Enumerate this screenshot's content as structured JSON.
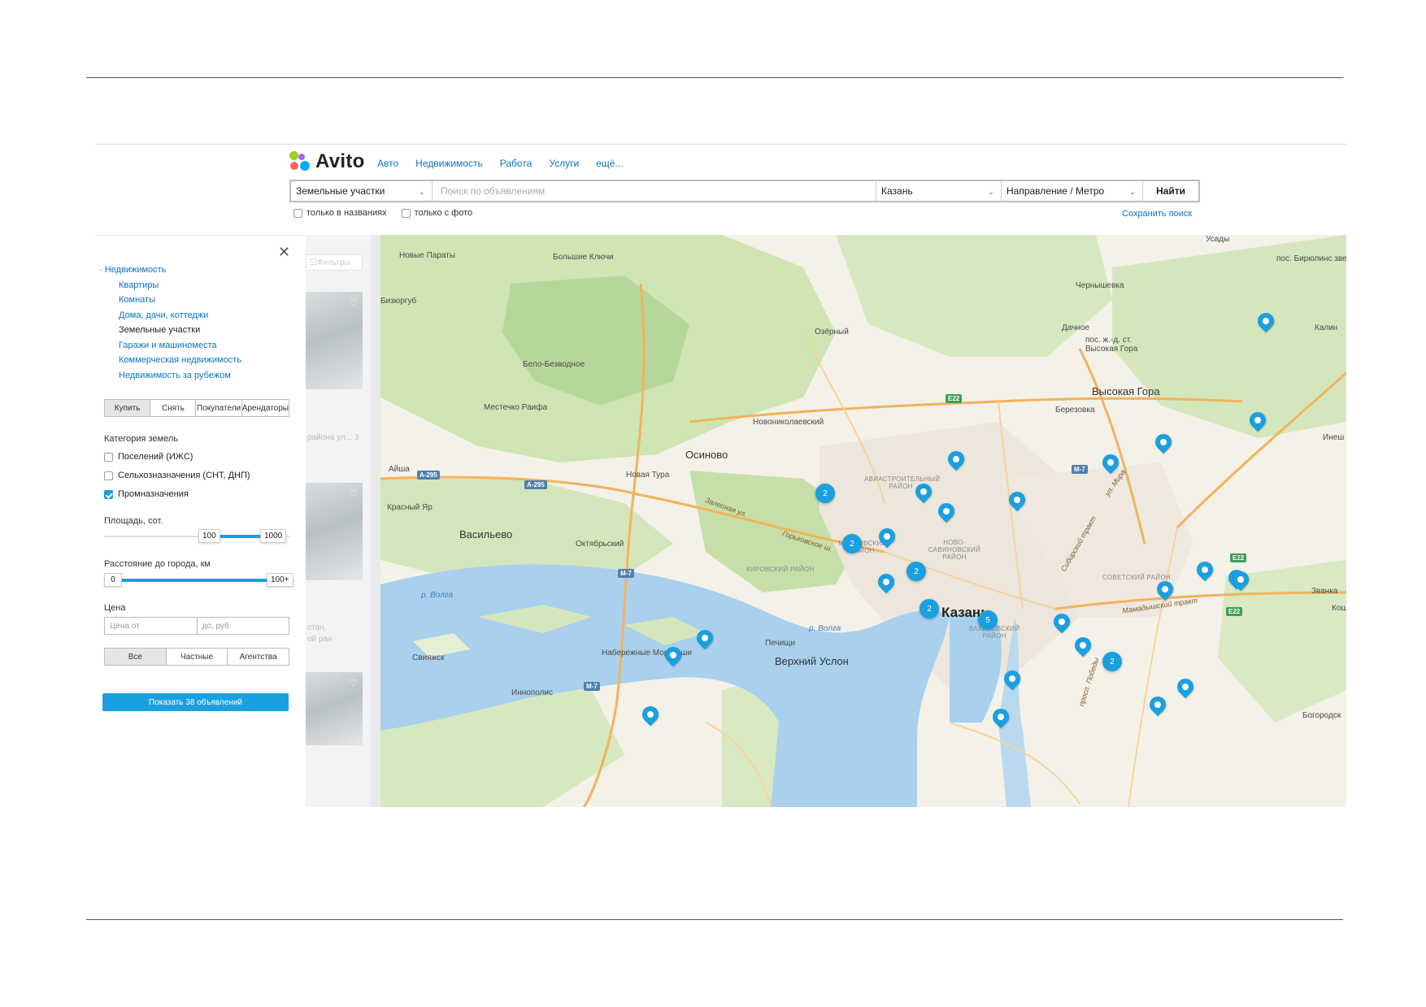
{
  "header": {
    "logo_text": "Avito",
    "logo_colors": [
      "#97cf26",
      "#a169f7",
      "#ff6163",
      "#0af"
    ],
    "nav": [
      "Авто",
      "Недвижимость",
      "Работа",
      "Услуги",
      "ещё..."
    ]
  },
  "search": {
    "category_value": "Земельные участки",
    "query_placeholder": "Поиск по объявлениям",
    "city_value": "Казань",
    "metro_value": "Направление / Метро",
    "submit_label": "Найти",
    "only_titles_label": "только в названиях",
    "only_photo_label": "только с фото",
    "save_search_label": "Сохранить поиск"
  },
  "filters": {
    "category_root": "Недвижимость",
    "categories": [
      {
        "label": "Квартиры",
        "active": false
      },
      {
        "label": "Комнаты",
        "active": false
      },
      {
        "label": "Дома, дачи, коттеджи",
        "active": false
      },
      {
        "label": "Земельные участки",
        "active": true
      },
      {
        "label": "Гаражи и машиноместа",
        "active": false
      },
      {
        "label": "Коммерческая недвижимость",
        "active": false
      },
      {
        "label": "Недвижимость за рубежом",
        "active": false
      }
    ],
    "deal_tabs": [
      {
        "label": "Купить",
        "selected": true
      },
      {
        "label": "Снять",
        "selected": false
      },
      {
        "label": "Покупатели",
        "selected": false
      },
      {
        "label": "Арендаторы",
        "selected": false
      }
    ],
    "land_category_title": "Категория земель",
    "land_options": [
      {
        "label": "Поселений (ИЖС)",
        "checked": false
      },
      {
        "label": "Сельхозназначения (СНТ, ДНП)",
        "checked": false
      },
      {
        "label": "Промназначения",
        "checked": true
      }
    ],
    "area_title": "Площадь, сот.",
    "area_from": "100",
    "area_to": "1000",
    "distance_title": "Расстояние до города, км",
    "distance_from": "0",
    "distance_to": "100+",
    "price_title": "Цена",
    "price_from_placeholder": "Цена от",
    "price_to_placeholder": "до, руб.",
    "seller_tabs": [
      {
        "label": "Все",
        "selected": true
      },
      {
        "label": "Частные",
        "selected": false
      },
      {
        "label": "Агентства",
        "selected": false
      }
    ],
    "show_button_label": "Показать 38 объявлений",
    "accent_color": "#1aa0e0"
  },
  "listing_ghost": {
    "filters_label": "Фильтры",
    "snippet_1": "района ул... 3",
    "snippet_2": "стан,",
    "snippet_3": "ой ран"
  },
  "map": {
    "places": {
      "bolshie_klyuchi": "Большие Ключи",
      "novye_paraty": "Новые Параты",
      "bizyurguy": "Бизюргуб",
      "ozerny": "Озёрный",
      "dachnoe": "Дачное",
      "chernyshevka": "Чернышевка",
      "pos_birulinsky": "пос. Бирюлинс зверосовхо",
      "kalin": "Калин",
      "pos_vysokaya_gora": "пос. ж.-д. ст. Высокая Гора",
      "vysokaya_gora": "Высокая Гора",
      "belo_bezvodnoe": "Бело-Безводное",
      "mestechko_raifa": "Местечко Раифа",
      "berezovka": "Березовка",
      "novonikolaevsky": "Новониколаевский",
      "inesh": "Инеш",
      "osinovo": "Осиново",
      "aisha": "Айша",
      "novaya_tura": "Новая Тура",
      "krasny_yar": "Красный Яр",
      "vasilevo": "Васильево",
      "oktyabrsky": "Октябрьский",
      "kazan": "Казань",
      "zvanka": "Званка",
      "kosh": "Кош",
      "sviyazhsk": "Свияжск",
      "morkvashi": "Набережные Моркваши",
      "pechishchi": "Печищи",
      "verkhny_uslon": "Верхний Услон",
      "innopolis": "Иннополис",
      "bogorodsk": "Богородск",
      "usady": "Усады"
    },
    "districts": {
      "aviastroitelny": "АВИАСТРОИТЕЛЬНЫЙ РАЙОН",
      "moskovsky": "МОСКОВСКИЙ РАЙОН",
      "novo_savinovsky": "НОВО-САВИНОВСКИЙ РАЙОН",
      "kirovsky": "КИРОВСКИЙ РАЙОН",
      "sovetsky": "СОВЕТСКИЙ РАЙОН",
      "vakhitovsky": "ВАХИТОВСКИЙ РАЙОН"
    },
    "water": {
      "volga_1": "р. Волга",
      "volga_2": "р. Волга"
    },
    "roads": {
      "zalesnaya": "Залесная ул.",
      "gorky": "Горьковское ш.",
      "mira": "ул. Мира",
      "sibirsky": "Сибирский тракт",
      "mamadysh": "Мамадышский тракт",
      "pobedy": "просп. Победы"
    },
    "shields": {
      "e22_a": "E22",
      "a295_a": "A-295",
      "a295_b": "A-295",
      "m7_a": "M-7",
      "m7_b": "M-7",
      "m7_c": "M-7",
      "e22_b": "E22",
      "e22_c": "E22"
    },
    "clusters": [
      "2",
      "2",
      "2",
      "2",
      "5",
      "2"
    ],
    "pin_color": "#1aa0e0"
  }
}
